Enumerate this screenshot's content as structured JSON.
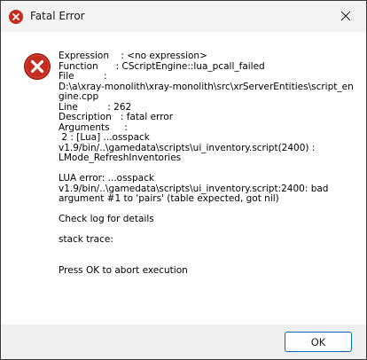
{
  "window": {
    "title": "Fatal Error"
  },
  "message": {
    "lines": [
      "Expression    : <no expression>",
      "Function      : CScriptEngine::lua_pcall_failed",
      "File          :",
      "D:\\a\\xray-monolith\\xray-monolith\\src\\xrServerEntities\\script_engine.cpp",
      "Line          : 262",
      "Description   : fatal error",
      "Arguments     :",
      " 2 : [Lua] ...osspack",
      "v1.9/bin/..\\gamedata\\scripts\\ui_inventory.script(2400) :",
      "LMode_RefreshInventories",
      "",
      "LUA error: ...osspack",
      "v1.9/bin/..\\gamedata\\scripts\\ui_inventory.script:2400: bad",
      "argument #1 to 'pairs' (table expected, got nil)",
      "",
      "Check log for details",
      "",
      "stack trace:",
      "",
      "",
      "Press OK to abort execution"
    ]
  },
  "buttons": {
    "ok_label": "OK"
  },
  "colors": {
    "error_red": "#c42b1c",
    "accent": "#0067c0"
  }
}
